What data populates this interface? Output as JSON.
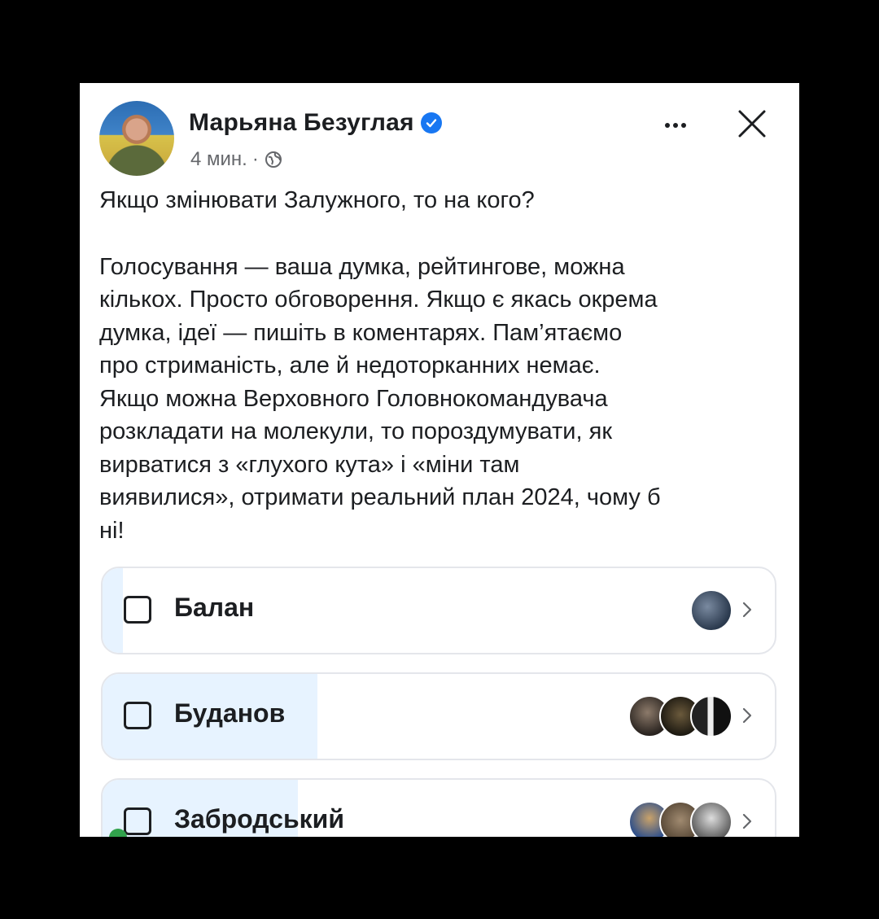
{
  "post": {
    "author": "Марьяна Безуглая",
    "time": "4 мин.",
    "separator": "·",
    "title_line": "Якщо змінювати Залужного, то на кого?",
    "body_lines": [
      "Голосування — ваша думка, рейтингове, можна",
      "кількох. Просто обговорення. Якщо є якась окрема",
      "думка, ідеї — пишіть в коментарях. Пам’ятаємо",
      "про стриманість, але й недоторканних немає.",
      "Якщо можна Верховного Головнокомандувача",
      "розкладати на молекули, то пороздумувати, як",
      "вирватися з «глухого кута» і «міни там",
      "виявилися», отримати реальний план 2024, чому б",
      "ні!"
    ]
  },
  "icons": {
    "verified": "verified-badge-icon",
    "privacy": "globe-icon",
    "more": "more-options-icon",
    "close": "close-icon",
    "chevron": "chevron-right-icon"
  },
  "colors": {
    "accent": "#1877f2",
    "poll_fill": "#e7f3ff",
    "online": "#31a24c"
  },
  "poll": {
    "options": [
      {
        "label": "Балан",
        "share": 0.03,
        "voters": 1
      },
      {
        "label": "Буданов",
        "share": 0.32,
        "voters": 3
      },
      {
        "label": "Забродський",
        "share": 0.29,
        "voters": 3
      }
    ]
  }
}
